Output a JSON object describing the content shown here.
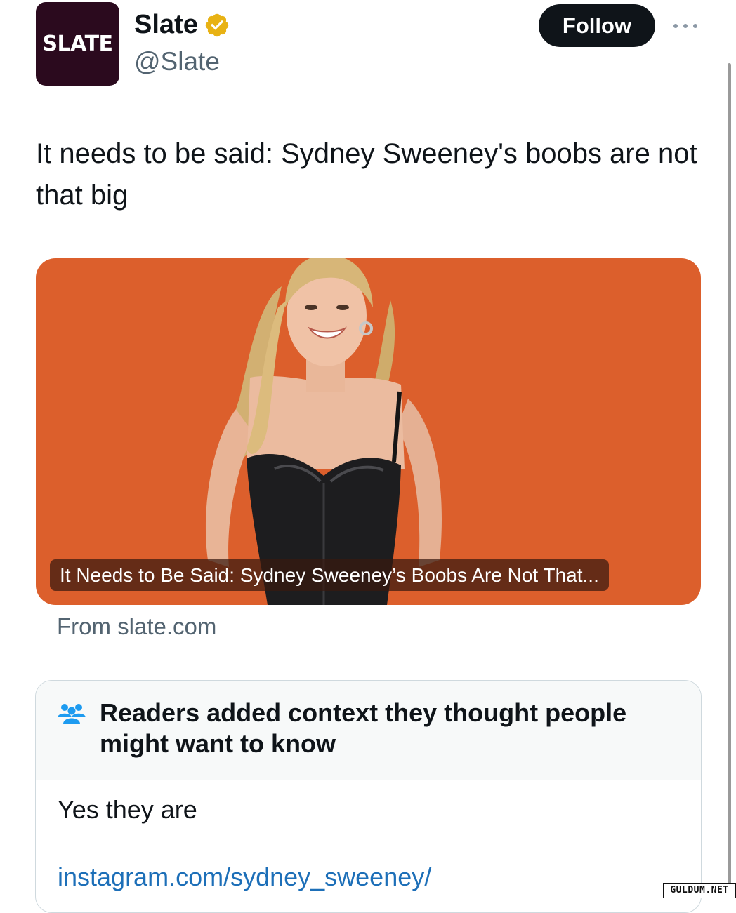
{
  "author": {
    "avatar_text": "SLATE",
    "display_name": "Slate",
    "handle": "@Slate",
    "verified_color": "#e8b214"
  },
  "header": {
    "follow_label": "Follow",
    "more_icon": "more-horizontal-icon"
  },
  "tweet": {
    "text": "It needs to be said: Sydney Sweeney's boobs are not that big"
  },
  "media": {
    "background_color": "#dc5f2c",
    "caption": "It Needs to Be Said: Sydney Sweeney’s Boobs Are Not That...",
    "source": "From slate.com"
  },
  "community_note": {
    "icon": "readers-icon",
    "title": "Readers added context they thought people might want to know",
    "body": "Yes they are",
    "link": "instagram.com/sydney_sweeney/",
    "link_color": "#1d6fb8"
  },
  "watermark": {
    "text": "GULDUM.NET"
  }
}
